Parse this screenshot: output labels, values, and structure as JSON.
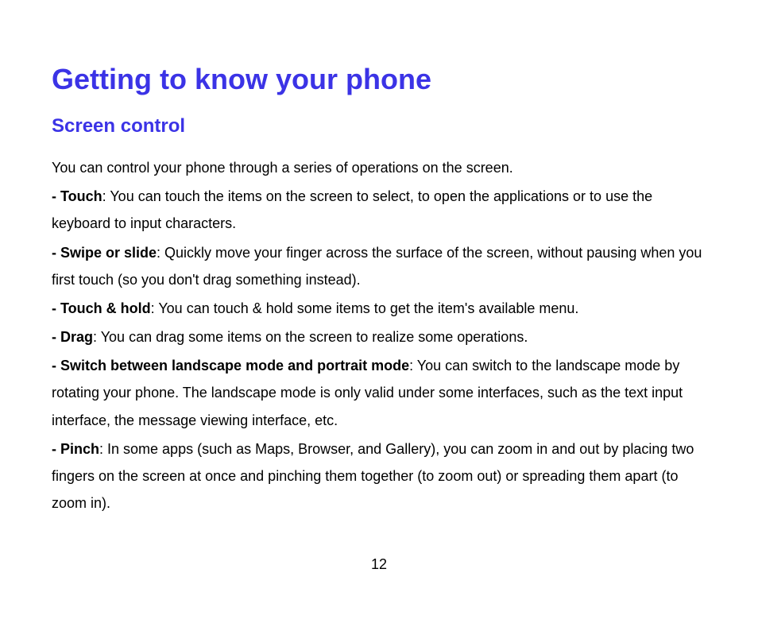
{
  "heading": "Getting to know your phone",
  "subheading": "Screen control",
  "intro": "You can control your phone through a series of operations on the screen.",
  "items": [
    {
      "label": "- Touch",
      "text": ": You can touch the items on the screen to select, to open the applications or to use the keyboard to input characters."
    },
    {
      "label": "- Swipe or slide",
      "text": ": Quickly move your finger across the surface of the screen, without pausing when you first touch (so you don't drag something instead)."
    },
    {
      "label": "- Touch & hold",
      "text": ": You can touch & hold some items to get the item's available menu."
    },
    {
      "label": "- Drag",
      "text": ": You can drag some items on the screen to realize some operations."
    },
    {
      "label": "- Switch between landscape mode and portrait mode",
      "text": ": You can switch to the landscape mode by rotating your phone. The landscape mode is only valid under some interfaces, such as the text input interface, the message viewing interface, etc."
    },
    {
      "label": "- Pinch",
      "text": ": In some apps (such as Maps, Browser, and Gallery), you can zoom in and out by placing two fingers on the screen at once and pinching them together (to zoom out) or spreading them apart (to zoom in)."
    }
  ],
  "page_number": "12",
  "colors": {
    "accent": "#3b33e6"
  }
}
